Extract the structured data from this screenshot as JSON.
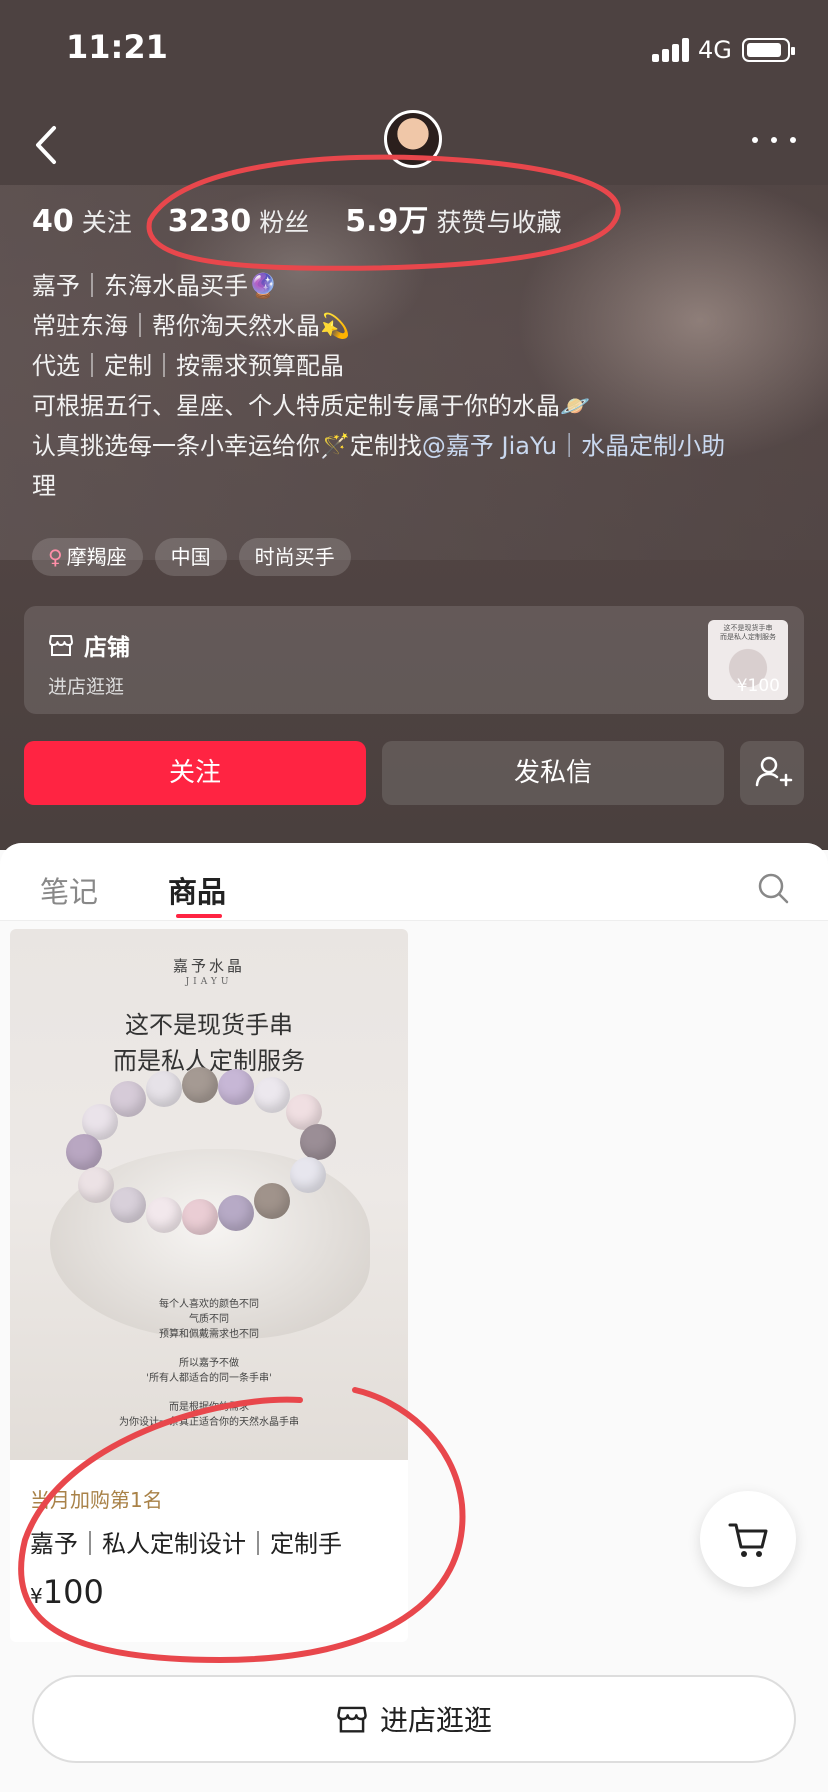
{
  "status_bar": {
    "time": "11:21",
    "network": "4G"
  },
  "profile": {
    "stats": [
      {
        "value": "40",
        "label": "关注"
      },
      {
        "value": "3230",
        "label": "粉丝"
      },
      {
        "value": "5.9万",
        "label": "获赞与收藏"
      }
    ],
    "bio_lines": [
      "嘉予｜东海水晶买手🔮",
      "常驻东海｜帮你淘天然水晶💫",
      "代选｜定制｜按需求预算配晶",
      "可根据五行、星座、个人特质定制专属于你的水晶🪐"
    ],
    "bio_last_prefix": "认真挑选每一条小幸运给你🪄定制找",
    "bio_mention": "@嘉予 JiaYu｜水晶定制小助",
    "bio_last_tail": "理",
    "tags": [
      {
        "symbol": "♀",
        "label": "摩羯座"
      },
      {
        "label": "中国"
      },
      {
        "label": "时尚买手"
      }
    ]
  },
  "shop_card": {
    "title": "店铺",
    "subtitle": "进店逛逛",
    "thumb_price": "¥100",
    "thumb_caption": "这不是现货手串\n而是私人定制服务"
  },
  "actions": {
    "follow": "关注",
    "message": "发私信"
  },
  "tabs": [
    {
      "label": "笔记"
    },
    {
      "label": "商品"
    }
  ],
  "product": {
    "image": {
      "brand": "嘉予水晶",
      "brand_en": "JIAYU",
      "headline_1": "这不是现货手串",
      "headline_2": "而是私人定制服务",
      "desc_1": "每个人喜欢的颜色不同",
      "desc_2": "气质不同",
      "desc_3": "预算和佩戴需求也不同",
      "desc_4": "所以嘉予不做",
      "desc_5": "'所有人都适合的同一条手串'",
      "desc_6": "而是根据你的需求",
      "desc_7": "为你设计一条真正适合你的天然水晶手串"
    },
    "rank": "当月加购第1名",
    "name": "嘉予｜私人定制设计｜定制手",
    "currency": "¥",
    "price": "100"
  },
  "enter_shop": "进店逛逛",
  "colors": {
    "accent": "#ff2442",
    "hero_bg": "#4d4241",
    "rank": "#a98248",
    "annotation": "#e8474c"
  }
}
